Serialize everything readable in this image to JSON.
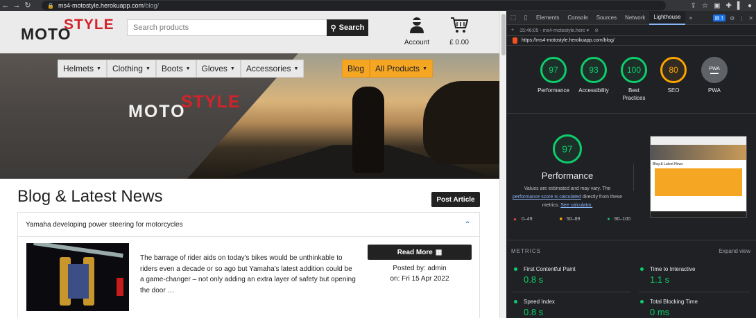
{
  "browser": {
    "url_host": "ms4-motostyle.herokuapp.com",
    "url_path": "/blog/"
  },
  "site": {
    "logo_moto": "MOTO",
    "logo_style": "STYLE",
    "search_placeholder": "Search products",
    "search_button": "Search",
    "account_label": "Account",
    "cart_total": "£ 0.00",
    "menu": [
      "Helmets",
      "Clothing",
      "Boots",
      "Gloves",
      "Accessories"
    ],
    "menu_orange": [
      "Blog",
      "All Products"
    ],
    "page_title": "Blog & Latest News",
    "post_button": "Post Article",
    "post": {
      "title": "Yamaha developing power steering for motorcycles",
      "excerpt": "The barrage of rider aids on today's bikes would be unthinkable to riders even a decade or so ago but Yamaha's latest addition could be a game-changer – not only adding an extra layer of safety but opening the door …",
      "read_more": "Read More",
      "posted_by": "Posted by: admin",
      "posted_on": "on: Fri 15 Apr 2022"
    }
  },
  "devtools": {
    "tabs": [
      "Elements",
      "Console",
      "Sources",
      "Network",
      "Lighthouse"
    ],
    "active_tab": "Lighthouse",
    "issues_badge": "1",
    "report_time": "15:46:05 - ms4-motostyle.herc",
    "audited_url": "https://ms4-motostyle.herokuapp.com/blog/",
    "scores": [
      {
        "value": "97",
        "label": "Performance",
        "color": "#0cce6b"
      },
      {
        "value": "93",
        "label": "Accessibility",
        "color": "#0cce6b"
      },
      {
        "value": "100",
        "label": "Best Practices",
        "color": "#0cce6b"
      },
      {
        "value": "80",
        "label": "SEO",
        "color": "#ffa400"
      },
      {
        "value": "PWA",
        "label": "PWA",
        "color": "#5f6368"
      }
    ],
    "perf_score": "97",
    "perf_title": "Performance",
    "perf_note_1": "Values are estimated and may vary. The",
    "perf_note_link": "performance score is calculated",
    "perf_note_2": "directly from these metrics.",
    "perf_note_link2": "See calculator.",
    "legend": [
      "0–49",
      "50–89",
      "90–100"
    ],
    "metrics_label": "METRICS",
    "expand_label": "Expand view",
    "metrics": [
      {
        "name": "First Contentful Paint",
        "value": "0.8 s"
      },
      {
        "name": "Time to Interactive",
        "value": "1.1 s"
      },
      {
        "name": "Speed Index",
        "value": "0.8 s"
      },
      {
        "name": "Total Blocking Time",
        "value": "0 ms"
      }
    ]
  }
}
